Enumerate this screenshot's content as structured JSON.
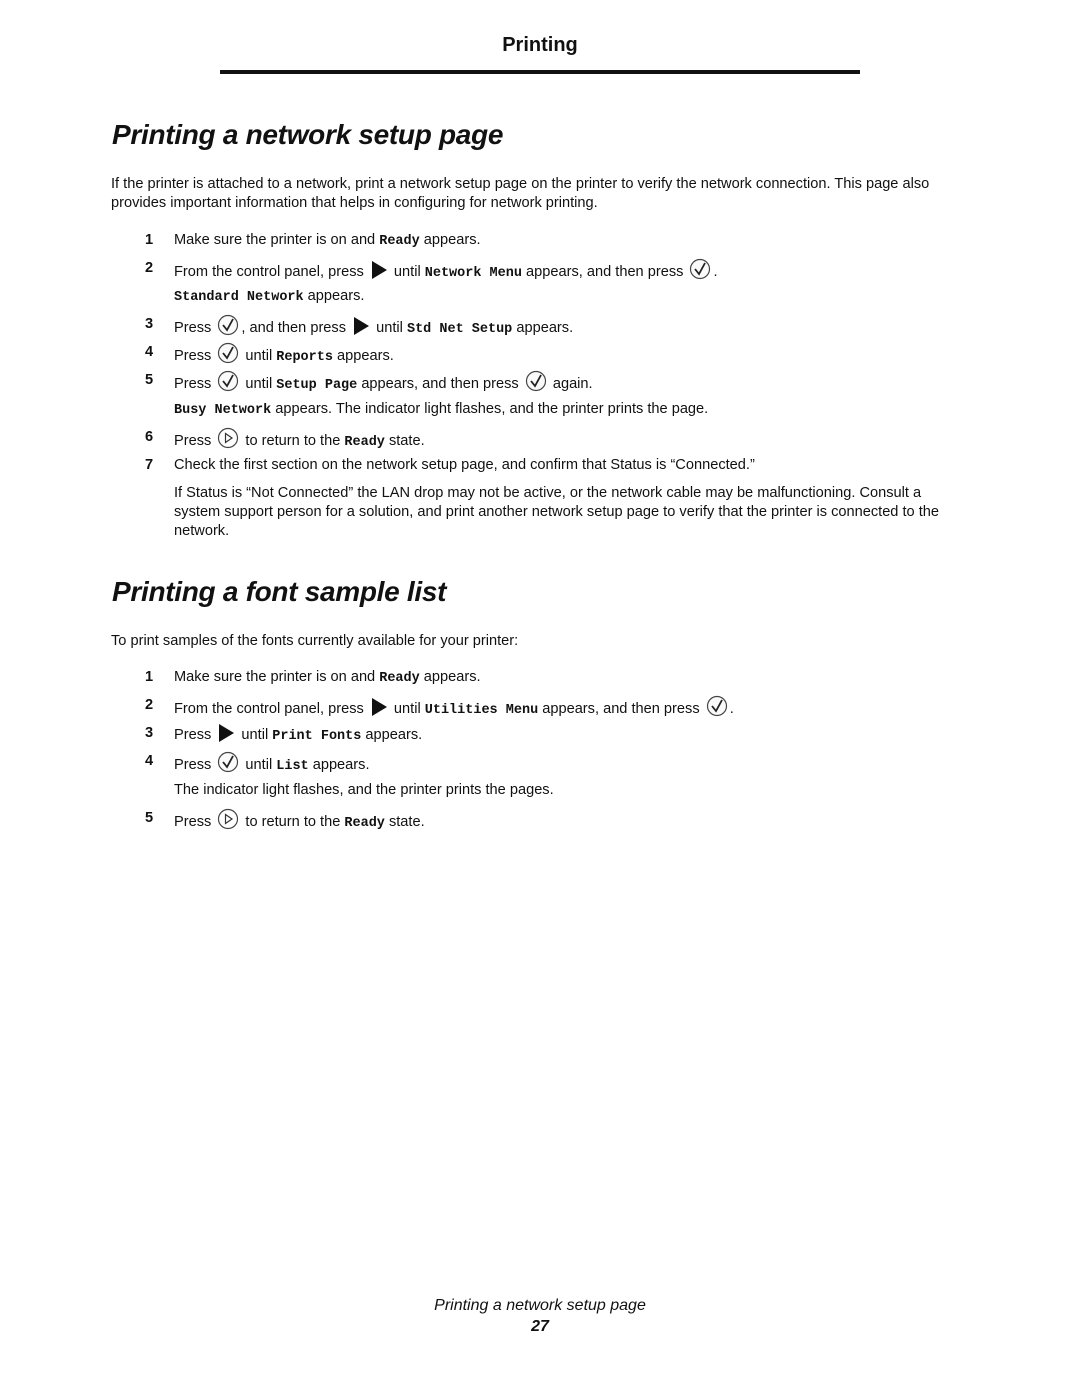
{
  "header": {
    "running_title": "Printing"
  },
  "section_network": {
    "title": "Printing a network setup page",
    "intro": "If the printer is attached to a network, print a network setup page on the printer to verify the network connection. This page also provides important information that helps in configuring for network printing.",
    "steps": [
      {
        "num": "1",
        "t1": "Make sure the printer is on and ",
        "m1": "Ready",
        "t2": " appears."
      },
      {
        "num": "2",
        "t1": "From the control panel, press ",
        "icon1": "right-arrow-icon",
        "t2": " until ",
        "m1": "Network Menu",
        "t3": " appears, and then press ",
        "icon2": "select-check-icon",
        "t4": "."
      },
      {
        "cont_m1": "Standard Network",
        "cont_t1": " appears."
      },
      {
        "num": "3",
        "t1": "Press ",
        "icon1": "select-check-icon",
        "t2": ", and then press ",
        "icon2": "right-arrow-icon",
        "t3": " until ",
        "m1": "Std Net Setup",
        "t4": " appears."
      },
      {
        "num": "4",
        "t1": "Press ",
        "icon1": "select-check-icon",
        "t2": " until ",
        "m1": "Reports",
        "t3": " appears."
      },
      {
        "num": "5",
        "t1": "Press ",
        "icon1": "select-check-icon",
        "t2": " until ",
        "m1": "Setup Page",
        "t3": " appears, and then press ",
        "icon2": "select-check-icon",
        "t4": " again."
      },
      {
        "cont_m1": "Busy Network",
        "cont_t1": " appears. The indicator light flashes, and the printer prints the page."
      },
      {
        "num": "6",
        "t1": "Press ",
        "icon1": "go-button-icon",
        "t2": " to return to the ",
        "m1": "Ready",
        "t3": " state."
      },
      {
        "num": "7",
        "t1": "Check the first section on the network setup page, and confirm that Status is “Connected.”"
      },
      {
        "note": "If Status is “Not Connected” the LAN drop may not be active, or the network cable may be malfunctioning. Consult a system support person for a solution, and print another network setup page to verify that the printer is connected to the network."
      }
    ]
  },
  "section_font": {
    "title": "Printing a font sample list",
    "intro": "To print samples of the fonts currently available for your printer:",
    "steps": [
      {
        "num": "1",
        "t1": "Make sure the printer is on and ",
        "m1": "Ready",
        "t2": " appears."
      },
      {
        "num": "2",
        "t1": "From the control panel, press ",
        "icon1": "right-arrow-icon",
        "t2": " until ",
        "m1": "Utilities Menu",
        "t3": " appears, and then press ",
        "icon2": "select-check-icon",
        "t4": "."
      },
      {
        "num": "3",
        "t1": "Press ",
        "icon1": "right-arrow-icon",
        "t2": " until ",
        "m1": "Print Fonts",
        "t3": " appears."
      },
      {
        "num": "4",
        "t1": "Press ",
        "icon1": "select-check-icon",
        "t2": " until ",
        "m1": "List",
        "t3": " appears."
      },
      {
        "cont_t1": "The indicator light flashes, and the printer prints the pages."
      },
      {
        "num": "5",
        "t1": "Press ",
        "icon1": "go-button-icon",
        "t2": " to return to the ",
        "m1": "Ready",
        "t3": " state."
      }
    ]
  },
  "footer": {
    "section_title": "Printing a network setup page",
    "page_number": "27"
  }
}
